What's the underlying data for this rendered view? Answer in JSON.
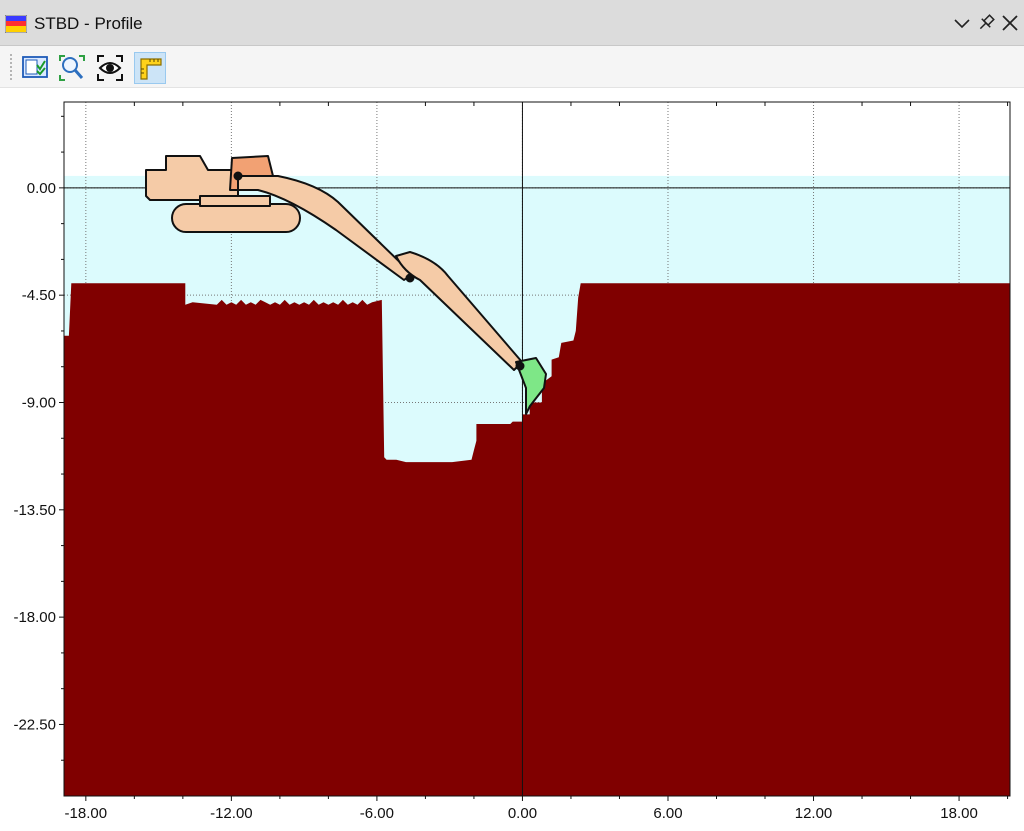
{
  "window": {
    "title": "STBD - Profile",
    "icons": [
      "profile-app-icon",
      "chevron-down-icon",
      "pin-icon",
      "close-icon"
    ]
  },
  "toolbar": {
    "buttons": [
      {
        "name": "layer-settings-icon",
        "active": false
      },
      {
        "name": "zoom-extents-icon",
        "active": false
      },
      {
        "name": "visibility-eye-icon",
        "active": false
      },
      {
        "name": "ruler-measure-icon",
        "active": true
      }
    ]
  },
  "colors": {
    "water": "#dcfbfd",
    "seabed": "#800000",
    "excavator_body": "#f5cba7",
    "excavator_cab": "#f2a173",
    "bucket": "#7ee787",
    "outline": "#111111"
  },
  "chart_data": {
    "type": "area",
    "title": "",
    "xlabel": "",
    "ylabel": "",
    "xlim": [
      -18.9,
      20.1
    ],
    "ylim": [
      -25.5,
      3.6
    ],
    "x_ticks": [
      -18,
      -12,
      -6,
      0,
      6,
      12,
      18
    ],
    "x_tick_labels": [
      "-18.00",
      "-12.00",
      "-6.00",
      "0.00",
      "6.00",
      "12.00",
      "18.00"
    ],
    "y_ticks": [
      0,
      -4.5,
      -9,
      -13.5,
      -18,
      -22.5
    ],
    "y_tick_labels": [
      "0.00",
      "-4.50",
      "-9.00",
      "-13.50",
      "-18.00",
      "-22.50"
    ],
    "grid": true,
    "water_level": 0.5,
    "series": [
      {
        "kind": "seabed",
        "x": [
          -18.9,
          -18.9,
          -18.7,
          -18.6,
          -13.9,
          -13.9,
          -13.6,
          -12.6,
          -12.4,
          -12.2,
          -12.0,
          -11.8,
          -11.6,
          -11.4,
          -11.2,
          -11.0,
          -10.8,
          -10.6,
          -10.4,
          -10.2,
          -10.0,
          -9.8,
          -9.6,
          -9.4,
          -9.2,
          -9.0,
          -8.8,
          -8.6,
          -8.4,
          -8.2,
          -8.0,
          -7.8,
          -7.6,
          -7.4,
          -7.2,
          -7.0,
          -6.8,
          -6.6,
          -6.4,
          -6.2,
          -5.8,
          -5.7,
          -5.6,
          -5.2,
          -4.8,
          -4.4,
          -3.9,
          -2.9,
          -2.1,
          -2.0,
          -1.9,
          -1.9,
          -1.8,
          -0.5,
          -0.4,
          0.0,
          0.0,
          0.3,
          0.3,
          0.8,
          0.8,
          1.2,
          1.2,
          1.5,
          1.6,
          2.1,
          2.2,
          2.3,
          2.4,
          20.1,
          20.1
        ],
        "y": [
          -25.5,
          -6.2,
          -6.2,
          -4.0,
          -4.0,
          -4.9,
          -4.8,
          -4.9,
          -4.7,
          -4.9,
          -4.8,
          -4.9,
          -4.7,
          -4.9,
          -4.8,
          -4.9,
          -4.7,
          -4.8,
          -4.9,
          -4.8,
          -4.9,
          -4.7,
          -4.9,
          -4.8,
          -4.9,
          -4.8,
          -4.9,
          -4.7,
          -4.9,
          -4.8,
          -4.9,
          -4.8,
          -4.9,
          -4.7,
          -4.9,
          -4.8,
          -4.9,
          -4.7,
          -4.9,
          -4.8,
          -4.7,
          -11.3,
          -11.4,
          -11.4,
          -11.5,
          -11.5,
          -11.5,
          -11.5,
          -11.4,
          -11.0,
          -10.6,
          -9.9,
          -9.9,
          -9.9,
          -9.8,
          -9.8,
          -9.5,
          -9.5,
          -9.0,
          -9.0,
          -8.2,
          -7.9,
          -7.2,
          -7.1,
          -6.5,
          -6.4,
          -6.0,
          -4.6,
          -4.0,
          -4.0,
          -25.5
        ]
      }
    ],
    "annotations": [
      "excavator"
    ]
  }
}
